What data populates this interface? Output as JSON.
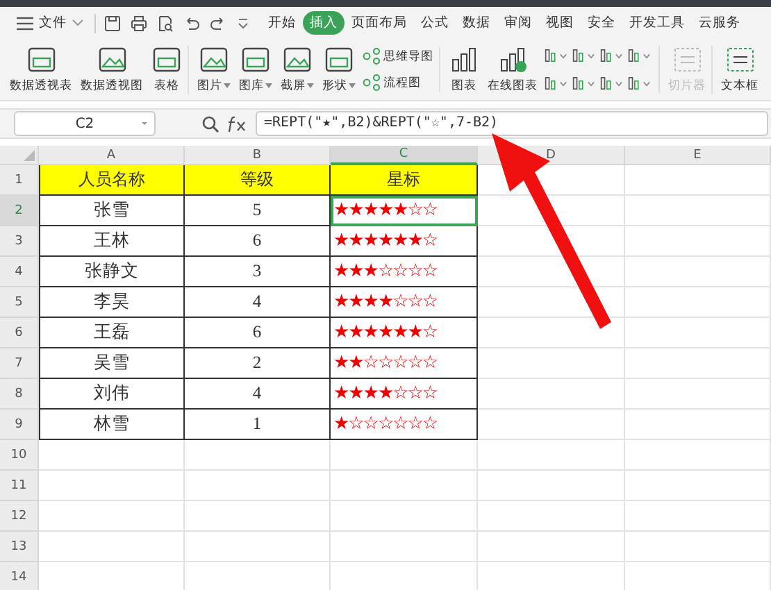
{
  "menu": {
    "file": "文件",
    "tabs": [
      {
        "label": "开始",
        "selected": false
      },
      {
        "label": "插入",
        "selected": true
      },
      {
        "label": "页面布局",
        "selected": false
      },
      {
        "label": "公式",
        "selected": false
      },
      {
        "label": "数据",
        "selected": false
      },
      {
        "label": "审阅",
        "selected": false
      },
      {
        "label": "视图",
        "selected": false
      },
      {
        "label": "安全",
        "selected": false
      },
      {
        "label": "开发工具",
        "selected": false
      },
      {
        "label": "云服务",
        "selected": false
      }
    ]
  },
  "ribbon": {
    "items": [
      {
        "label": "数据透视表",
        "dropdown": false,
        "disabled": false
      },
      {
        "label": "数据透视图",
        "dropdown": false,
        "disabled": false
      },
      {
        "label": "表格",
        "dropdown": false,
        "disabled": false
      },
      {
        "label": "图片",
        "dropdown": true,
        "disabled": false
      },
      {
        "label": "图库",
        "dropdown": true,
        "disabled": false
      },
      {
        "label": "截屏",
        "dropdown": true,
        "disabled": false
      },
      {
        "label": "形状",
        "dropdown": true,
        "disabled": false
      }
    ],
    "small_items": [
      {
        "label": "思维导图"
      },
      {
        "label": "流程图"
      }
    ],
    "items_2": [
      {
        "label": "图表",
        "disabled": false
      },
      {
        "label": "在线图表",
        "disabled": false
      }
    ],
    "items_3": [
      {
        "label": "切片器",
        "disabled": true
      },
      {
        "label": "文本框",
        "disabled": false
      }
    ]
  },
  "formula_bar": {
    "name_box": "C2",
    "formula": "=REPT(\"★\",B2)&REPT(\"☆\",7-B2)"
  },
  "sheet": {
    "columns": [
      {
        "label": "A",
        "selected": false
      },
      {
        "label": "B",
        "selected": false
      },
      {
        "label": "C",
        "selected": true
      },
      {
        "label": "D",
        "selected": false
      },
      {
        "label": "E",
        "selected": false
      }
    ],
    "rows": [
      {
        "number": "1",
        "kind": "header",
        "selected": false,
        "cells": [
          "人员名称",
          "等级",
          "星标"
        ]
      },
      {
        "number": "2",
        "kind": "data",
        "selected": true,
        "cells": [
          "张雪",
          "5",
          "★★★★★☆☆"
        ]
      },
      {
        "number": "3",
        "kind": "data",
        "selected": false,
        "cells": [
          "王林",
          "6",
          "★★★★★★☆"
        ]
      },
      {
        "number": "4",
        "kind": "data",
        "selected": false,
        "cells": [
          "张静文",
          "3",
          "★★★☆☆☆☆"
        ]
      },
      {
        "number": "5",
        "kind": "data",
        "selected": false,
        "cells": [
          "李昊",
          "4",
          "★★★★☆☆☆"
        ]
      },
      {
        "number": "6",
        "kind": "data",
        "selected": false,
        "cells": [
          "王磊",
          "6",
          "★★★★★★☆"
        ]
      },
      {
        "number": "7",
        "kind": "data",
        "selected": false,
        "cells": [
          "吴雪",
          "2",
          "★★☆☆☆☆☆"
        ]
      },
      {
        "number": "8",
        "kind": "data",
        "selected": false,
        "cells": [
          "刘伟",
          "4",
          "★★★★☆☆☆"
        ]
      },
      {
        "number": "9",
        "kind": "data",
        "selected": false,
        "cells": [
          "林雪",
          "1",
          "★☆☆☆☆☆☆"
        ]
      },
      {
        "number": "10",
        "selected": false
      },
      {
        "number": "11",
        "selected": false
      },
      {
        "number": "12",
        "selected": false
      },
      {
        "number": "13",
        "selected": false
      },
      {
        "number": "14",
        "selected": false
      }
    ]
  }
}
